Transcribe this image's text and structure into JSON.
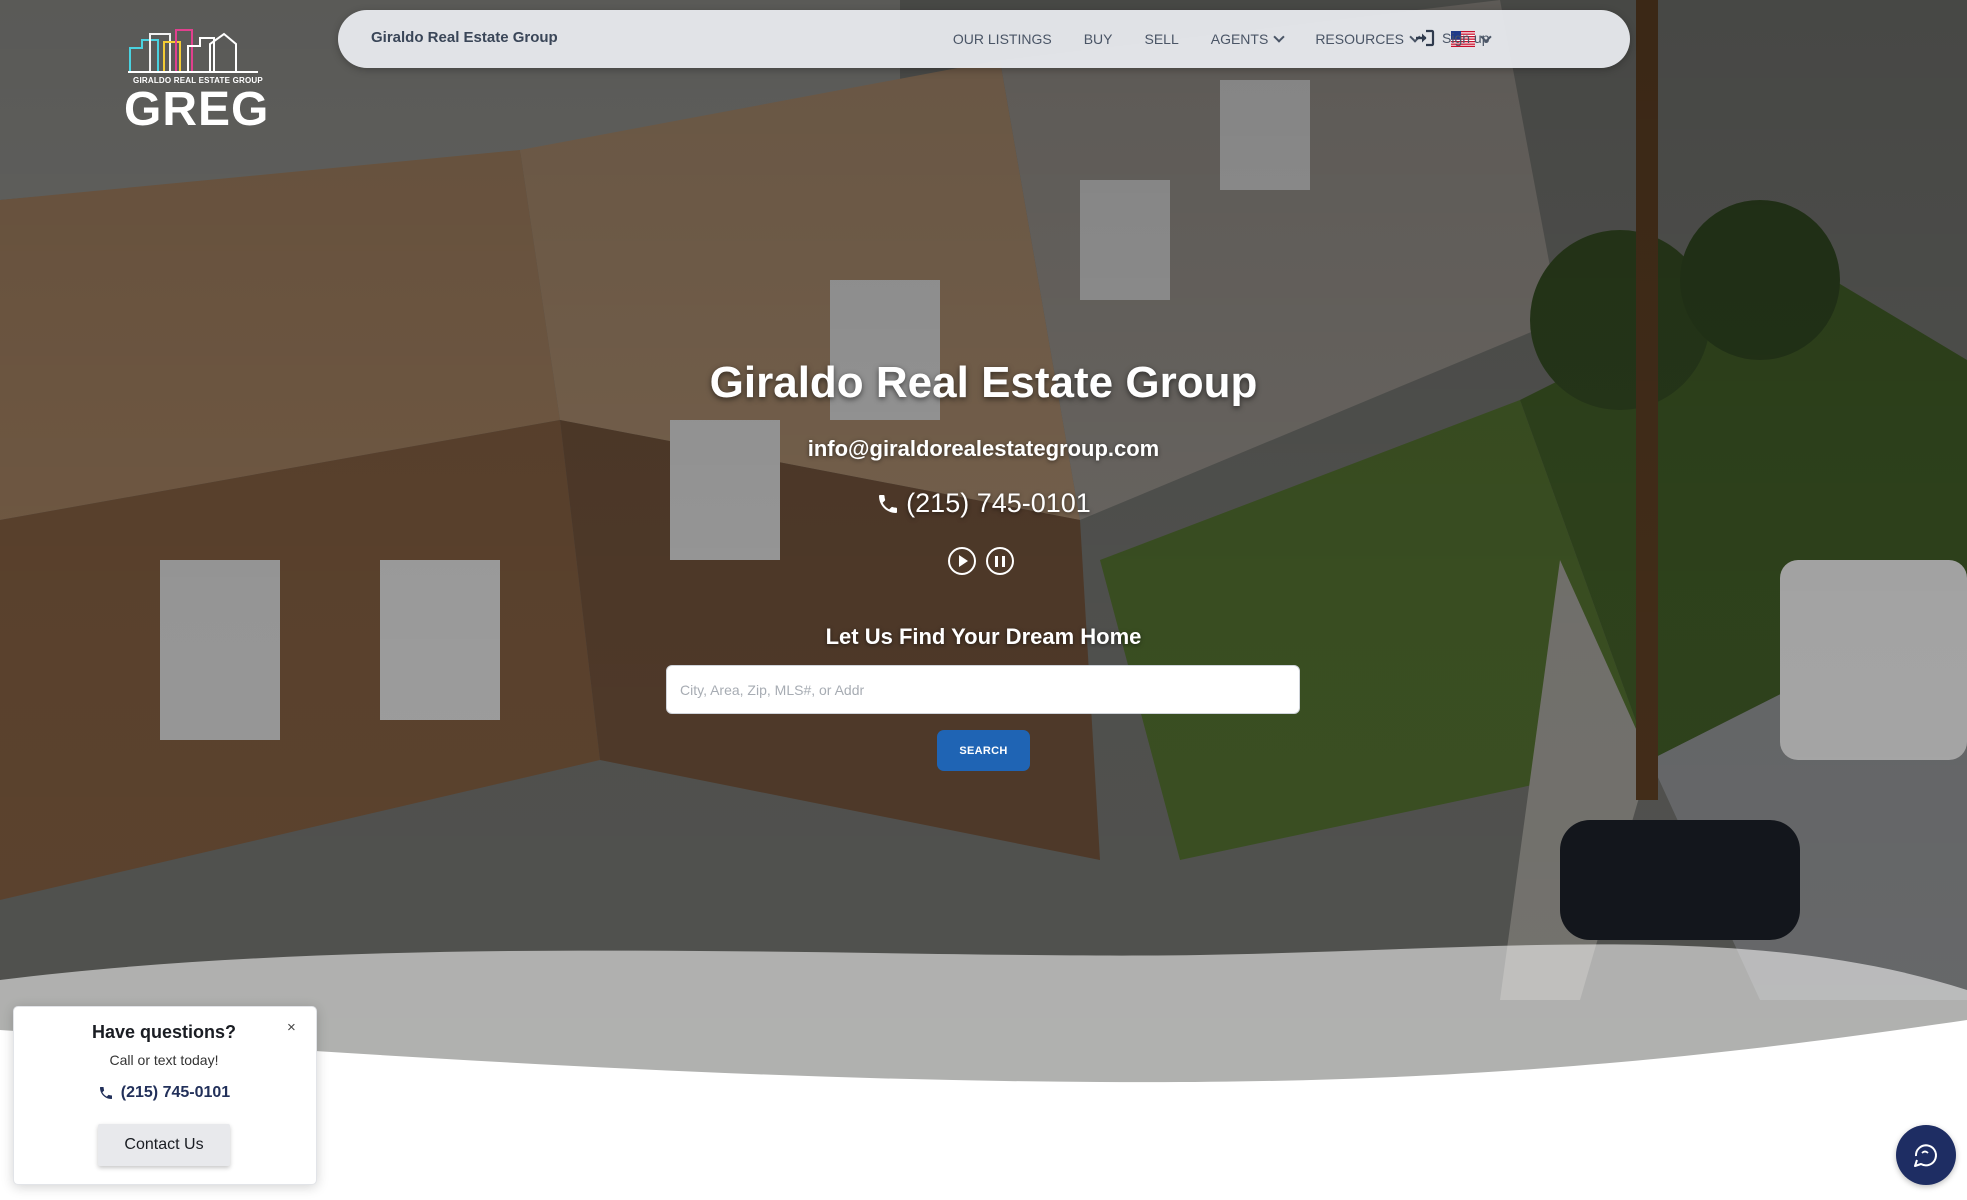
{
  "logo": {
    "small_text": "GIRALDO REAL ESTATE GROUP",
    "main_text": "GREG"
  },
  "nav": {
    "brand": "Giraldo Real Estate Group",
    "items": [
      {
        "label": "OUR LISTINGS",
        "has_dropdown": false
      },
      {
        "label": "BUY",
        "has_dropdown": false
      },
      {
        "label": "SELL",
        "has_dropdown": false
      },
      {
        "label": "AGENTS",
        "has_dropdown": true
      },
      {
        "label": "RESOURCES",
        "has_dropdown": true
      }
    ],
    "language_icon": "us-flag-icon",
    "signup_label": "Sign up",
    "signup_icon": "sign-in-icon"
  },
  "hero": {
    "title": "Giraldo Real Estate Group",
    "email": "info@giraldorealestategroup.com",
    "phone": "(215) 745-0101",
    "media_controls": [
      "play-icon",
      "pause-icon"
    ]
  },
  "search": {
    "heading": "Let Us Find Your Dream Home",
    "placeholder": "City, Area, Zip, MLS#, or Addr",
    "value": "",
    "button_label": "SEARCH"
  },
  "questions_widget": {
    "title": "Have questions?",
    "subtitle": "Call or text today!",
    "phone": "(215) 745-0101",
    "button_label": "Contact Us",
    "close_label": "×"
  },
  "chat": {
    "icon": "chat-icon"
  },
  "colors": {
    "nav_bg": "#eceef2",
    "search_button": "#1f64b4",
    "chat_button": "#1e2d63",
    "widget_phone": "#22305a"
  }
}
